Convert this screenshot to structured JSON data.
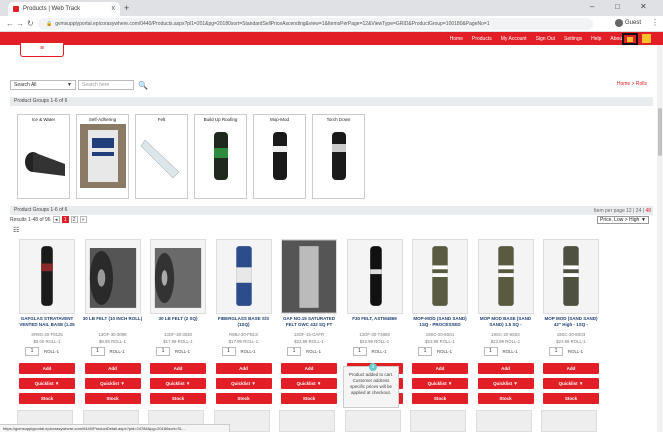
{
  "browser": {
    "tab_title": "Products | Web Track",
    "tab_close": "x",
    "new_tab": "+",
    "url": "gvmsupplyportal.epicorasywhere.com/0440/Products.aspx?pl1=201&pg=20180sort=StandardSellPriceAscending&view=1&ItemsPerPage=12&ViewType=GRID&ProductGroup=100180&PageNo=1",
    "account": "Guest",
    "minimize": "–",
    "maximize": "□",
    "close": "✕",
    "status_url": "https://gvmsupplyportal.epicorasywhere.com/0440/ProductDetail.aspx?pid=24784&pg=20180sort=SL…"
  },
  "site": {
    "hamburger": "≡",
    "nav": [
      "Home",
      "Products",
      "My Account",
      "Sign Out",
      "Settings",
      "Help",
      "About Us"
    ],
    "accent": "#e21f26"
  },
  "search": {
    "scope": "Search All",
    "placeholder": "Search here"
  },
  "breadcrumb": "Home > Rolls",
  "groups_header": "Product Groups 1-6 of 6",
  "categories": [
    {
      "label": "Ice & Water"
    },
    {
      "label": "Self-Adhering"
    },
    {
      "label": "Felt"
    },
    {
      "label": "Build Up Roofing"
    },
    {
      "label": "Mop-Mod"
    },
    {
      "label": "Torch Down"
    }
  ],
  "products_header": "Product Groups 1-6 of 6",
  "results_text": "Results 1-48 of 96",
  "pages": [
    "1",
    "2",
    "»"
  ],
  "per_page_label": "Item per page",
  "per_page_options": [
    "12",
    "24",
    "48"
  ],
  "sort_value": "Price, Low > High",
  "products": [
    {
      "name": "GAFGLAS STRATAVENT VENTED NAIL BASE (1.25 SQ)",
      "sku": "SR8G-20-F8125",
      "price": "$0.00 ROLL-1",
      "qty": "1",
      "unit": "ROLL-1"
    },
    {
      "name": "30 LB FELT (10 INCH ROLL)",
      "sku": "13OF-30-3098",
      "price": "$8.99 ROLL-1",
      "qty": "1",
      "unit": "ROLL-1"
    },
    {
      "name": "30 LB FELT (2 SQ)",
      "sku": "13OF-30-3030",
      "price": "$17.99 ROLL-1",
      "qty": "1",
      "unit": "ROLL-1"
    },
    {
      "name": "FIBERGLASS BASE S/S (1SQ)",
      "sku": "R8BJ-20-FB1S",
      "price": "$17.99 ROLL-1",
      "qty": "1",
      "unit": "ROLL-1"
    },
    {
      "name": "GAF NO.15 SATURATED FELT GWC 432 SQ FT (RED)",
      "sku": "13OF-15-GAFR",
      "price": "$22.99 ROLL-1",
      "qty": "1",
      "unit": "ROLL-1"
    },
    {
      "name": "F30 FELT, ASTM4869",
      "sku": "13OF-30-T4869",
      "price": "$22.99 ROLL-1",
      "qty": "1",
      "unit": "ROLL-1"
    },
    {
      "name": "MOP-MOD (SAND SAND) 1SQ - PROCESSED",
      "sku": "19SC-20-8S01",
      "price": "$23.99 ROLL-1",
      "qty": "1",
      "unit": "ROLL-1"
    },
    {
      "name": "MOP MOD BASE (SAND SAND) 1.5 SQ - PROCESSED",
      "sku": "19SC-20-8S02",
      "price": "$23.99 ROLL-1",
      "qty": "1",
      "unit": "ROLL-1"
    },
    {
      "name": "MOP MOD (SAND SAND) 42\" High - 1SQ - PROCESSED",
      "sku": "19SC-20-8S03",
      "price": "$23.99 ROLL-1",
      "qty": "1",
      "unit": "ROLL-1"
    }
  ],
  "buttons": {
    "add": "Add",
    "quicklist": "Quicklist ▼",
    "stock": "Stock"
  },
  "toast": {
    "close": "x",
    "message": "Product added to cart. Customer address specific prices will be applied at checkout."
  }
}
